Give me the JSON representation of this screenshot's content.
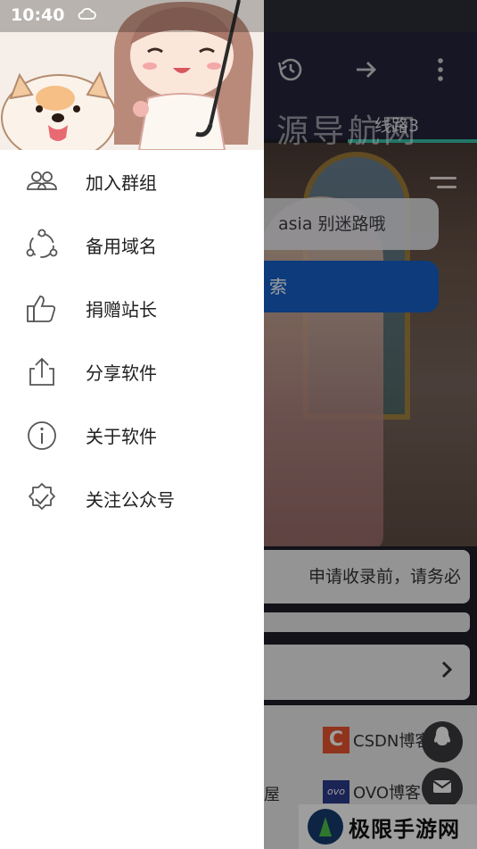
{
  "status_bar": {
    "time": "10:40"
  },
  "app": {
    "tab_label": "线路3",
    "hero_title": "源导航网",
    "search_placeholder": "asia 别迷路哦",
    "search_button": "索",
    "notice_text": "申请收录前，请务必",
    "links": [
      {
        "label": "CSDN博客",
        "icon": "csdn-logo"
      },
      {
        "label": "OVO博客",
        "icon": "ovo-logo"
      }
    ],
    "partial_link": "屋",
    "watermark": "极限手游网"
  },
  "drawer": {
    "menu": [
      {
        "label": "加入群组",
        "icon": "group-icon"
      },
      {
        "label": "备用域名",
        "icon": "share-nodes-icon"
      },
      {
        "label": "捐赠站长",
        "icon": "thumbs-up-icon"
      },
      {
        "label": "分享软件",
        "icon": "upload-share-icon"
      },
      {
        "label": "关于软件",
        "icon": "info-icon"
      },
      {
        "label": "关注公众号",
        "icon": "verified-badge-icon"
      }
    ]
  },
  "colors": {
    "accent": "#36c0a8",
    "search_button": "#1560c8",
    "app_bar": "#25253a"
  }
}
